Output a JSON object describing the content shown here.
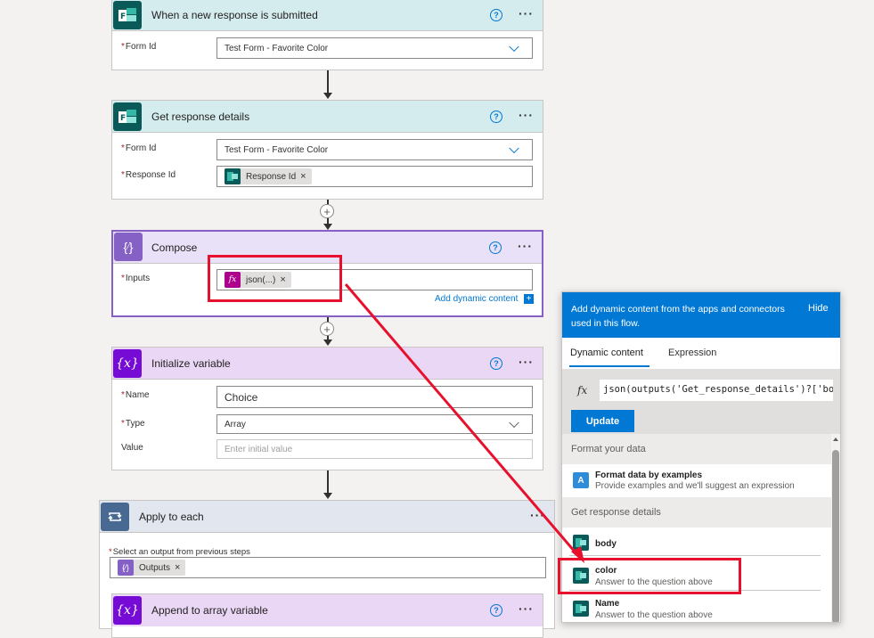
{
  "steps": {
    "trigger": {
      "title": "When a new response is submitted",
      "form_id_label": "Form Id",
      "form_id_value": "Test Form - Favorite Color"
    },
    "get_details": {
      "title": "Get response details",
      "form_id_label": "Form Id",
      "form_id_value": "Test Form - Favorite Color",
      "response_id_label": "Response Id",
      "response_id_token": "Response Id"
    },
    "compose": {
      "title": "Compose",
      "inputs_label": "Inputs",
      "inputs_token": "json(...)",
      "add_dynamic_label": "Add dynamic content"
    },
    "init_var": {
      "title": "Initialize variable",
      "name_label": "Name",
      "name_value": "Choice",
      "type_label": "Type",
      "type_value": "Array",
      "value_label": "Value",
      "value_placeholder": "Enter initial value"
    },
    "apply_each": {
      "title": "Apply to each",
      "select_label": "Select an output from previous steps",
      "outputs_token": "Outputs"
    },
    "append": {
      "title": "Append to array variable"
    }
  },
  "panel": {
    "header_text": "Add dynamic content from the apps and connectors used in this flow.",
    "hide_label": "Hide",
    "tabs": [
      "Dynamic content",
      "Expression"
    ],
    "expression_value": "json(outputs('Get_response_details')?['bod",
    "update_label": "Update",
    "sections": [
      {
        "title": "Format your data",
        "items": [
          {
            "name": "Format data by examples",
            "desc": "Provide examples and we'll suggest an expression"
          }
        ]
      },
      {
        "title": "Get response details",
        "items": [
          {
            "name": "body",
            "desc": ""
          },
          {
            "name": "color",
            "desc": "Answer to the question above"
          },
          {
            "name": "Name",
            "desc": "Answer to the question above"
          }
        ]
      }
    ]
  },
  "icons": {
    "help": "?",
    "more": "···",
    "plus": "+",
    "fx": "fx",
    "remove": "×"
  },
  "colors": {
    "forms_teal": "#0b5a5a",
    "compose_purple": "#8661c5",
    "variable_purple": "#770bd6",
    "loop_slate": "#486991",
    "accent_blue": "#0078d4",
    "annotation_red": "#e8112d"
  }
}
